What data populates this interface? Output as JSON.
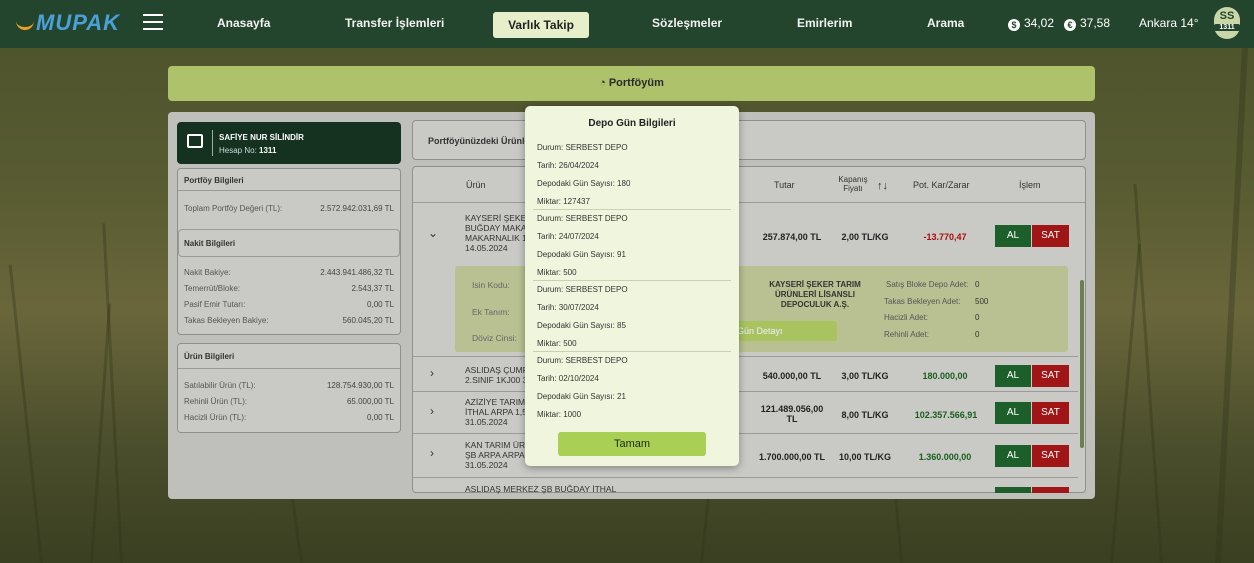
{
  "nav": {
    "logo": "MUPAK",
    "items": [
      "Anasayfa",
      "Transfer İşlemleri",
      "Varlık Takip",
      "Sözleşmeler",
      "Emirlerim",
      "Arama"
    ],
    "usd": "34,02",
    "eur": "37,58",
    "weather": "Ankara 14°",
    "avatar_initials": "SS",
    "avatar_no": "1311"
  },
  "portfolio_bar": "Portföyüm",
  "user": {
    "name": "SAFİYE NUR SİLİNDİR",
    "account_label": "Hesap No:",
    "account_no": "1311"
  },
  "portfoy_bilgileri": {
    "title": "Portföy Bilgileri",
    "rows": [
      {
        "label": "Toplam Portföy Değeri (TL):",
        "value": "2.572.942.031,69 TL"
      }
    ]
  },
  "nakit_bilgileri": {
    "title": "Nakit Bilgileri",
    "rows": [
      {
        "label": "Nakit Bakiye:",
        "value": "2.443.941.486,32 TL"
      },
      {
        "label": "Temerrüt/Bloke:",
        "value": "2.543,37 TL"
      },
      {
        "label": "Pasif Emir Tutarı:",
        "value": "0,00 TL"
      },
      {
        "label": "Takas Bekleyen Bakiye:",
        "value": "560.045,20 TL"
      }
    ]
  },
  "urun_bilgileri": {
    "title": "Ürün Bilgileri",
    "rows": [
      {
        "label": "Satılabilir Ürün (TL):",
        "value": "128.754.930,00 TL"
      },
      {
        "label": "Rehinli Ürün (TL):",
        "value": "65.000,00 TL"
      },
      {
        "label": "Hacizli Ürün (TL):",
        "value": "0,00 TL"
      }
    ]
  },
  "table": {
    "header_title": "Portföyünüzdeki Ürünle",
    "columns": {
      "urun": "Ürün",
      "tutar": "Tutar",
      "kapanis1": "Kapanış",
      "kapanis2": "Fiyatı",
      "sort": "↑↓",
      "kar": "Pot. Kar/Zarar",
      "islem": "İşlem"
    },
    "buy": "AL",
    "sell": "SAT",
    "rows": [
      {
        "l1": "KAYSERİ ŞEKER",
        "l2": "BUĞDAY MAKA",
        "l3": "MAKARNALIK 1",
        "l4": "14.05.2024",
        "tutar": "257.874,00 TL",
        "fiyat": "2,00 TL/KG",
        "kar": "-13.770,47"
      },
      {
        "l1": "ASLIDAŞ ÇUMF",
        "l2": "2.SINIF 1KJ00 3",
        "l3": "",
        "l4": "",
        "tutar": "540.000,00 TL",
        "fiyat": "3,00 TL/KG",
        "kar": "180.000,00"
      },
      {
        "l1": "AZİZİYE TARIM",
        "l2": "İTHAL ARPA 1,5",
        "l3": "31.05.2024",
        "l4": "",
        "tutar": "121.489.056,00",
        "tutar2": "TL",
        "fiyat": "8,00 TL/KG",
        "kar": "102.357.566,91"
      },
      {
        "l1": "KAN TARIM ÜR",
        "l2": "ŞB ARPA ARPA",
        "l3": "31.05.2024",
        "l4": "",
        "tutar": "1.700.000,00 TL",
        "fiyat": "10,00 TL/KG",
        "kar": "1.360.000,00"
      },
      {
        "l1": "ASLIDAŞ MERKEZ ŞB BUĞDAY İTHAL",
        "l2": "",
        "l3": "",
        "l4": "",
        "tutar": "",
        "fiyat": "",
        "kar": ""
      }
    ],
    "detail": {
      "isin": "Isin Kodu:",
      "ek": "Ek Tanım:",
      "doviz": "Döviz Cinsi:",
      "company1": "KAYSERİ ŞEKER TARIM",
      "company2": "ÜRÜNLERİ LİSANSLI",
      "company3": "DEPOCULUK A.Ş.",
      "gun_detay": "Gün Detayı",
      "satis_bloke": "Satış Bloke Depo Adet:",
      "satis_bloke_v": "0",
      "takas": "Takas Bekleyen Adet:",
      "takas_v": "500",
      "hacizli": "Hacizli Adet:",
      "hacizli_v": "0",
      "rehinli": "Rehinli Adet:",
      "rehinli_v": "0"
    }
  },
  "modal": {
    "title": "Depo Gün Bilgileri",
    "entries": [
      {
        "durum": "Durum: SERBEST DEPO",
        "tarih": "Tarih: 26/04/2024",
        "gun": "Depodaki Gün Sayısı: 180",
        "miktar": "Miktar: 127437"
      },
      {
        "durum": "Durum: SERBEST DEPO",
        "tarih": "Tarih: 24/07/2024",
        "gun": "Depodaki Gün Sayısı: 91",
        "miktar": "Miktar: 500"
      },
      {
        "durum": "Durum: SERBEST DEPO",
        "tarih": "Tarih: 30/07/2024",
        "gun": "Depodaki Gün Sayısı: 85",
        "miktar": "Miktar: 500"
      },
      {
        "durum": "Durum: SERBEST DEPO",
        "tarih": "Tarih: 02/10/2024",
        "gun": "Depodaki Gün Sayısı: 21",
        "miktar": "Miktar: 1000"
      }
    ],
    "ok": "Tamam"
  }
}
